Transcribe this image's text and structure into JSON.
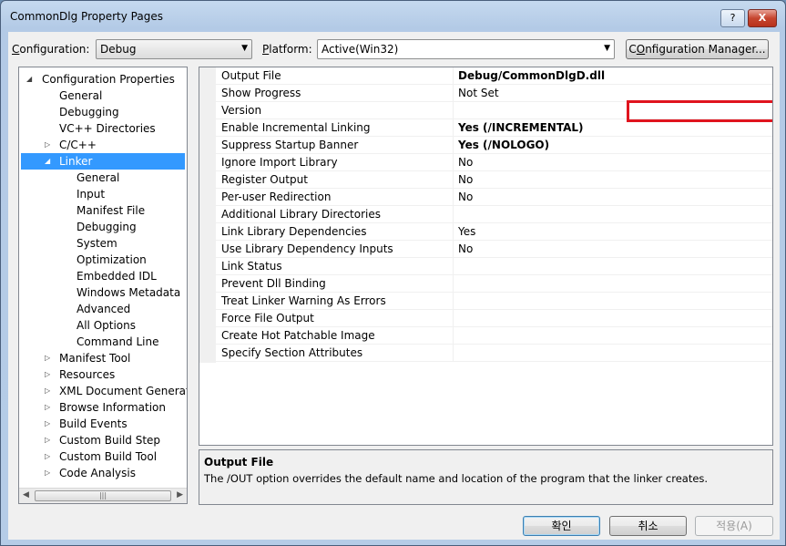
{
  "window": {
    "title": "CommonDlg Property Pages",
    "help_label": "?",
    "close_label": "X"
  },
  "top": {
    "configuration_label_u": "C",
    "configuration_label_rest": "onfiguration:",
    "configuration_value": "Debug",
    "platform_label_u": "P",
    "platform_label_rest": "latform:",
    "platform_value": "Active(Win32)",
    "config_manager_label_u": "O",
    "config_manager_label_pre": "C",
    "config_manager_label_rest": "nfiguration Manager..."
  },
  "tree": {
    "items": [
      {
        "label": "Configuration Properties",
        "expander": "◢"
      },
      {
        "label": "General",
        "expander": ""
      },
      {
        "label": "Debugging",
        "expander": ""
      },
      {
        "label": "VC++ Directories",
        "expander": ""
      },
      {
        "label": "C/C++",
        "expander": "▷"
      },
      {
        "label": "Linker",
        "expander": "◢"
      },
      {
        "label": "General",
        "expander": ""
      },
      {
        "label": "Input",
        "expander": ""
      },
      {
        "label": "Manifest File",
        "expander": ""
      },
      {
        "label": "Debugging",
        "expander": ""
      },
      {
        "label": "System",
        "expander": ""
      },
      {
        "label": "Optimization",
        "expander": ""
      },
      {
        "label": "Embedded IDL",
        "expander": ""
      },
      {
        "label": "Windows Metadata",
        "expander": ""
      },
      {
        "label": "Advanced",
        "expander": ""
      },
      {
        "label": "All Options",
        "expander": ""
      },
      {
        "label": "Command Line",
        "expander": ""
      },
      {
        "label": "Manifest Tool",
        "expander": "▷"
      },
      {
        "label": "Resources",
        "expander": "▷"
      },
      {
        "label": "XML Document Generator",
        "expander": "▷"
      },
      {
        "label": "Browse Information",
        "expander": "▷"
      },
      {
        "label": "Build Events",
        "expander": "▷"
      },
      {
        "label": "Custom Build Step",
        "expander": "▷"
      },
      {
        "label": "Custom Build Tool",
        "expander": "▷"
      },
      {
        "label": "Code Analysis",
        "expander": "▷"
      }
    ],
    "selected": "Linker",
    "scroll_left": "◀",
    "scroll_right": "▶",
    "scroll_grip": "|||"
  },
  "properties": [
    {
      "name": "Output File",
      "value": "Debug/CommonDlgD.dll",
      "bold": true
    },
    {
      "name": "Show Progress",
      "value": "Not Set",
      "bold": false
    },
    {
      "name": "Version",
      "value": "",
      "bold": false
    },
    {
      "name": "Enable Incremental Linking",
      "value": "Yes (/INCREMENTAL)",
      "bold": true
    },
    {
      "name": "Suppress Startup Banner",
      "value": "Yes (/NOLOGO)",
      "bold": true
    },
    {
      "name": "Ignore Import Library",
      "value": "No",
      "bold": false
    },
    {
      "name": "Register Output",
      "value": "No",
      "bold": false
    },
    {
      "name": "Per-user Redirection",
      "value": "No",
      "bold": false
    },
    {
      "name": "Additional Library Directories",
      "value": "",
      "bold": false
    },
    {
      "name": "Link Library Dependencies",
      "value": "Yes",
      "bold": false
    },
    {
      "name": "Use Library Dependency Inputs",
      "value": "No",
      "bold": false
    },
    {
      "name": "Link Status",
      "value": "",
      "bold": false
    },
    {
      "name": "Prevent Dll Binding",
      "value": "",
      "bold": false
    },
    {
      "name": "Treat Linker Warning As Errors",
      "value": "",
      "bold": false
    },
    {
      "name": "Force File Output",
      "value": "",
      "bold": false
    },
    {
      "name": "Create Hot Patchable Image",
      "value": "",
      "bold": false
    },
    {
      "name": "Specify Section Attributes",
      "value": "",
      "bold": false
    }
  ],
  "description": {
    "title": "Output File",
    "text": "The /OUT option overrides the default name and location of the program that the linker creates."
  },
  "buttons": {
    "ok": "확인",
    "cancel": "취소",
    "apply": "적용(A)"
  },
  "colors": {
    "selection": "#3399ff",
    "highlight_box": "#e0141e"
  }
}
